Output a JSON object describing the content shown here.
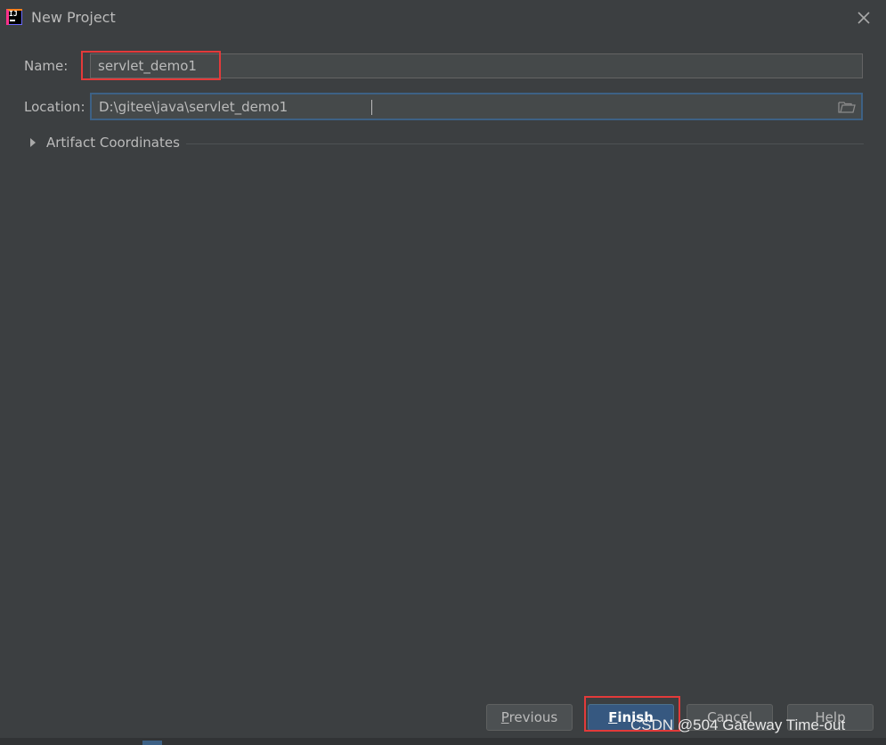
{
  "window": {
    "title": "New Project",
    "close_label": "×"
  },
  "form": {
    "name_label": "Name:",
    "name_value": "servlet_demo1",
    "location_label": "Location:",
    "location_value": "D:\\gitee\\java\\servlet_demo1"
  },
  "sections": {
    "artifact_coordinates": "Artifact Coordinates",
    "expanded": false
  },
  "buttons": {
    "previous": {
      "mnemonic": "P",
      "rest": "revious"
    },
    "finish": {
      "mnemonic": "F",
      "rest": "inish"
    },
    "cancel": "Cancel",
    "help": "Help"
  },
  "watermark": "CSDN @504 Gateway Time-out",
  "colors": {
    "background": "#3c3f41",
    "field": "#45494a",
    "focus_border": "#3d6185",
    "highlight": "#e33a3a",
    "default_button": "#365880"
  },
  "icons": [
    "intellij-icon",
    "close-icon",
    "folder-icon",
    "expand-arrow-icon"
  ]
}
